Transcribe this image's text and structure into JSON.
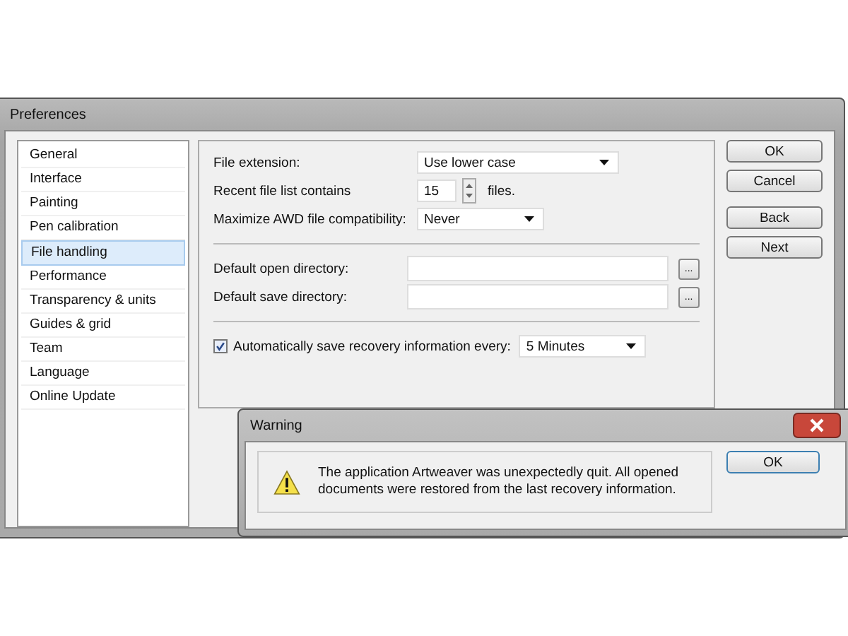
{
  "preferences_window": {
    "title": "Preferences",
    "categories": [
      {
        "label": "General",
        "selected": false
      },
      {
        "label": "Interface",
        "selected": false
      },
      {
        "label": "Painting",
        "selected": false
      },
      {
        "label": "Pen calibration",
        "selected": false
      },
      {
        "label": "File handling",
        "selected": true
      },
      {
        "label": "Performance",
        "selected": false
      },
      {
        "label": "Transparency & units",
        "selected": false
      },
      {
        "label": "Guides & grid",
        "selected": false
      },
      {
        "label": "Team",
        "selected": false
      },
      {
        "label": "Language",
        "selected": false
      },
      {
        "label": "Online Update",
        "selected": false
      }
    ],
    "settings": [
      {
        "kind": "select",
        "label": "File extension:",
        "value": "Use lower case"
      },
      {
        "kind": "spinner",
        "label": "Recent file list contains",
        "value": "15",
        "suffix": "files."
      },
      {
        "kind": "select",
        "label": "Maximize AWD file compatibility:",
        "value": "Never"
      },
      {
        "kind": "divider"
      },
      {
        "kind": "directory",
        "label": "Default open directory:",
        "browse": "..."
      },
      {
        "kind": "directory",
        "label": "Default save directory:",
        "browse": "..."
      },
      {
        "kind": "divider"
      },
      {
        "kind": "checkbox-select",
        "label": "Automatically save recovery information every:",
        "checked": true,
        "value": "5 Minutes"
      }
    ],
    "buttons": [
      "OK",
      "Cancel",
      "Back",
      "Next"
    ]
  },
  "warning": {
    "title": "Warning",
    "message": "The application Artweaver was unexpectedly quit. All opened documents were restored from the last recovery information.",
    "button": "OK"
  }
}
